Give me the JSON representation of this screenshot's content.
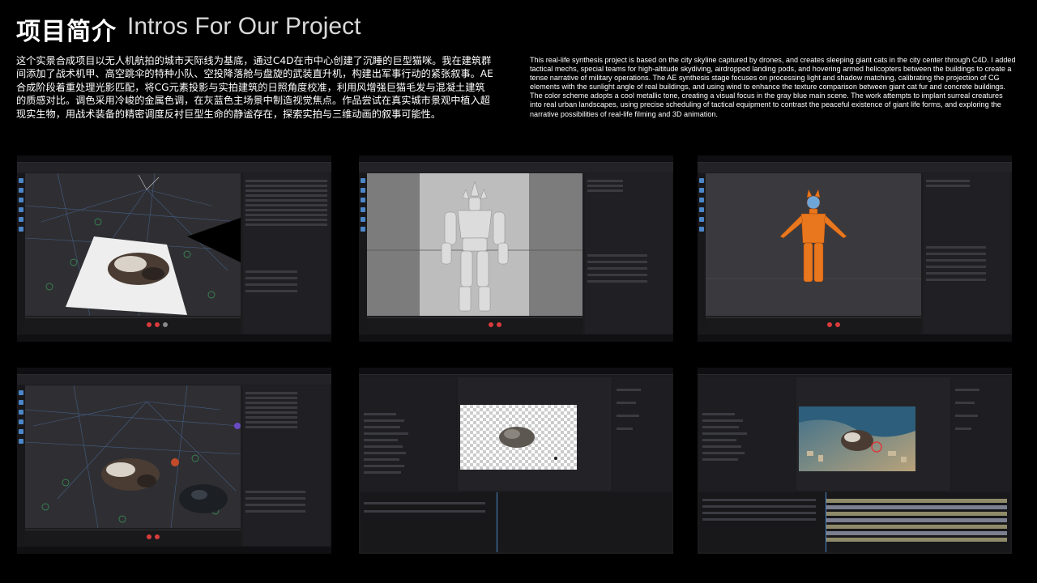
{
  "header": {
    "title_cn": "项目简介",
    "title_en": "Intros For Our Project"
  },
  "intro": {
    "cn": "这个实景合成项目以无人机航拍的城市天际线为基底，通过C4D在市中心创建了沉睡的巨型猫咪。我在建筑群间添加了战术机甲、高空跳伞的特种小队、空投降落舱与盘旋的武装直升机，构建出军事行动的紧张叙事。AE合成阶段着重处理光影匹配，将CG元素投影与实拍建筑的日照角度校准，利用风增强巨猫毛发与混凝土建筑的质感对比。调色采用冷峻的金属色调，在灰蓝色主场景中制造视觉焦点。作品尝试在真实城市景观中植入超现实生物，用战术装备的精密调度反衬巨型生命的静谧存在，探索实拍与三维动画的叙事可能性。",
    "en": "This real-life synthesis project is based on the city skyline captured by drones, and creates sleeping giant cats in the city center through C4D. I added tactical mechs, special teams for high-altitude skydiving, airdropped landing pods, and hovering armed helicopters between the buildings to create a tense narrative of military operations. The AE synthesis stage focuses on processing light and shadow matching, calibrating the projection of CG elements with the sunlight angle of real buildings, and using wind to enhance the texture comparison between giant cat fur and concrete buildings. The color scheme adopts a cool metallic tone, creating a visual focus in the gray blue main scene. The work attempts to implant surreal creatures into real urban landscapes, using precise scheduling of tactical equipment to contrast the peaceful existence of giant life forms, and exploring the narrative possibilities of real-life filming and 3D animation."
  },
  "screenshots": [
    {
      "app": "c4d",
      "content": "cat-on-plane",
      "icon": "cinema4d-window"
    },
    {
      "app": "c4d",
      "content": "mech-model-grey",
      "icon": "cinema4d-window"
    },
    {
      "app": "c4d",
      "content": "orange-rigged-figure",
      "icon": "cinema4d-window"
    },
    {
      "app": "c4d",
      "content": "cat-scene-with-props",
      "icon": "cinema4d-window"
    },
    {
      "app": "after-effects",
      "content": "cat-on-transparent-comp",
      "icon": "after-effects-window"
    },
    {
      "app": "after-effects",
      "content": "aerial-city-composite",
      "icon": "after-effects-window"
    }
  ],
  "colors": {
    "background": "#000000",
    "ui_dark": "#1c1c1f",
    "c4d_accent": "#4b86c8",
    "figure_orange": "#e8771d",
    "timeline_red": "#d93b3b"
  }
}
